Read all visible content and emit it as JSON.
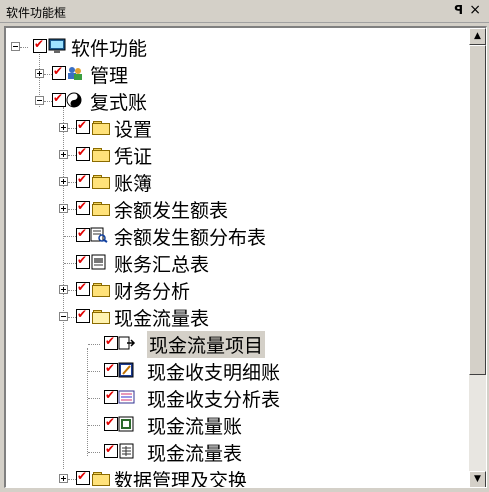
{
  "window": {
    "title": "软件功能框",
    "pin_glyph": "ꟼ",
    "close_glyph": "×"
  },
  "tree": {
    "root": {
      "label": "软件功能"
    },
    "items": [
      {
        "label": "管理"
      },
      {
        "label": "复式账"
      },
      {
        "label": "设置"
      },
      {
        "label": "凭证"
      },
      {
        "label": "账簿"
      },
      {
        "label": "余额发生额表"
      },
      {
        "label": "余额发生额分布表"
      },
      {
        "label": "账务汇总表"
      },
      {
        "label": "财务分析"
      },
      {
        "label": "现金流量表"
      },
      {
        "label": "现金流量项目"
      },
      {
        "label": "现金收支明细账"
      },
      {
        "label": "现金收支分析表"
      },
      {
        "label": "现金流量账"
      },
      {
        "label": "现金流量表"
      },
      {
        "label": "数据管理及交换"
      }
    ]
  },
  "scrollbar": {
    "up_glyph": "▲",
    "down_glyph": "▼"
  }
}
